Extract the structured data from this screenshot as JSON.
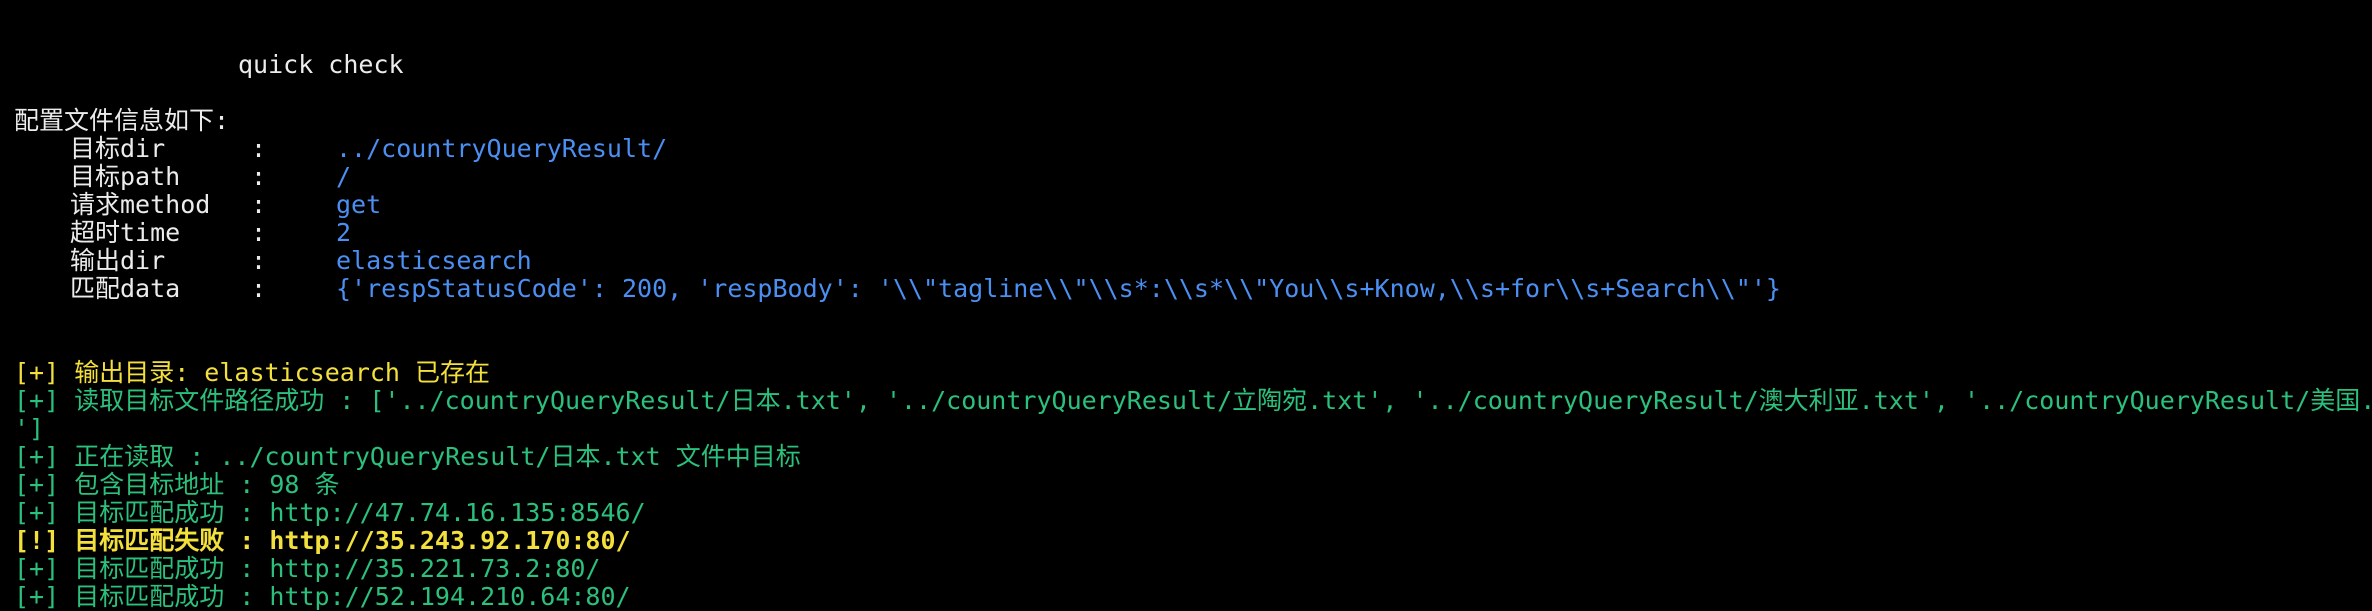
{
  "title": "quick check",
  "config": {
    "header": "配置文件信息如下:",
    "rows": [
      {
        "key": "目标dir",
        "colon": ":",
        "value": "../countryQueryResult/"
      },
      {
        "key": "目标path",
        "colon": ":",
        "value": "/"
      },
      {
        "key": "请求method",
        "colon": ":",
        "value": "get"
      },
      {
        "key": "超时time",
        "colon": ":",
        "value": "2"
      },
      {
        "key": "输出dir",
        "colon": ":",
        "value": "elasticsearch"
      },
      {
        "key": "匹配data",
        "colon": ":",
        "value": "{'respStatusCode': 200, 'respBody': '\\\\\"tagline\\\\\"\\\\s*:\\\\s*\\\\\"You\\\\s+Know,\\\\s+for\\\\s+Search\\\\\"'}"
      }
    ]
  },
  "log": {
    "output_exists": "[+] 输出目录: elasticsearch 已存在",
    "read_paths_1": "[+] 读取目标文件路径成功 : ['../countryQueryResult/日本.txt', '../countryQueryResult/立陶宛.txt', '../countryQueryResult/澳大利亚.txt', '../countryQueryResult/美国.txt",
    "read_paths_2": "']",
    "reading_file": "[+] 正在读取 : ../countryQueryResult/日本.txt 文件中目标",
    "target_count": "[+] 包含目标地址 : 98 条",
    "match_1": "[+] 目标匹配成功 : http://47.74.16.135:8546/",
    "fail_1": "[!] 目标匹配失败 : http://35.243.92.170:80/",
    "match_2": "[+] 目标匹配成功 : http://35.221.73.2:80/",
    "match_3": "[+] 目标匹配成功 : http://52.194.210.64:80/"
  },
  "colors": {
    "background": "#000000",
    "default_text": "#ececec",
    "value_blue": "#4c8ff2",
    "success_green": "#2bc07b",
    "warning_yellow": "#f3e03c"
  }
}
